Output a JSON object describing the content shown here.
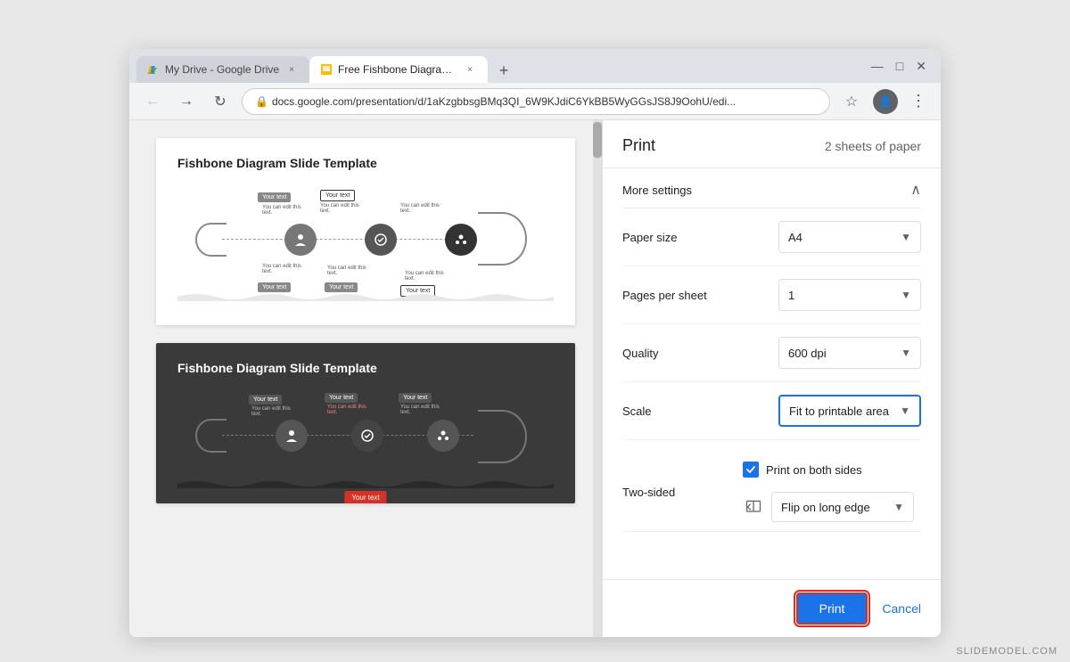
{
  "browser": {
    "tabs": [
      {
        "id": "tab-drive",
        "title": "My Drive - Google Drive",
        "favicon": "drive",
        "active": false
      },
      {
        "id": "tab-slides",
        "title": "Free Fishbone Diagram Slide Tem...",
        "favicon": "slides",
        "active": true
      }
    ],
    "new_tab_label": "+",
    "address": "docs.google.com/presentation/d/1aKzgbbsgBMq3QI_6W9KJdiC6YkBB5WyGGsJS8J9OohU/edi...",
    "window_controls": [
      "minimize",
      "maximize",
      "close"
    ],
    "profile_label": "Guest",
    "nav": {
      "back_label": "←",
      "forward_label": "→",
      "refresh_label": "↻"
    }
  },
  "slides": {
    "slide1": {
      "title": "Fishbone Diagram Slide Template",
      "theme": "light",
      "text_nodes": [
        "Your text",
        "You can edit this text.",
        "Your text",
        "You can edit this text.",
        "Your text",
        "You can edit this text.",
        "Your text",
        "You can edit this text.",
        "Your text",
        "Your text"
      ]
    },
    "slide2": {
      "title": "Fishbone Diagram Slide Template",
      "theme": "dark",
      "text_nodes": [
        "Your text",
        "You can edit this text.",
        "Your text",
        "You can edit this text.",
        "Your text",
        "You can edit this text."
      ]
    }
  },
  "print_panel": {
    "title": "Print",
    "sheets_info": "2 sheets of paper",
    "more_settings_label": "More settings",
    "settings": [
      {
        "id": "paper-size",
        "label": "Paper size",
        "value": "A4",
        "has_dropdown": true
      },
      {
        "id": "pages-per-sheet",
        "label": "Pages per sheet",
        "value": "1",
        "has_dropdown": true
      },
      {
        "id": "quality",
        "label": "Quality",
        "value": "600 dpi",
        "has_dropdown": true
      },
      {
        "id": "scale",
        "label": "Scale",
        "value": "Fit to printable area",
        "has_dropdown": true,
        "highlighted": true
      }
    ],
    "two_sided": {
      "label": "Two-sided",
      "checkbox_label": "Print on both sides",
      "checked": true,
      "flip_label": "Flip on long edge"
    },
    "buttons": {
      "print": "Print",
      "cancel": "Cancel"
    }
  },
  "watermark": "SLIDEMODEL.COM"
}
